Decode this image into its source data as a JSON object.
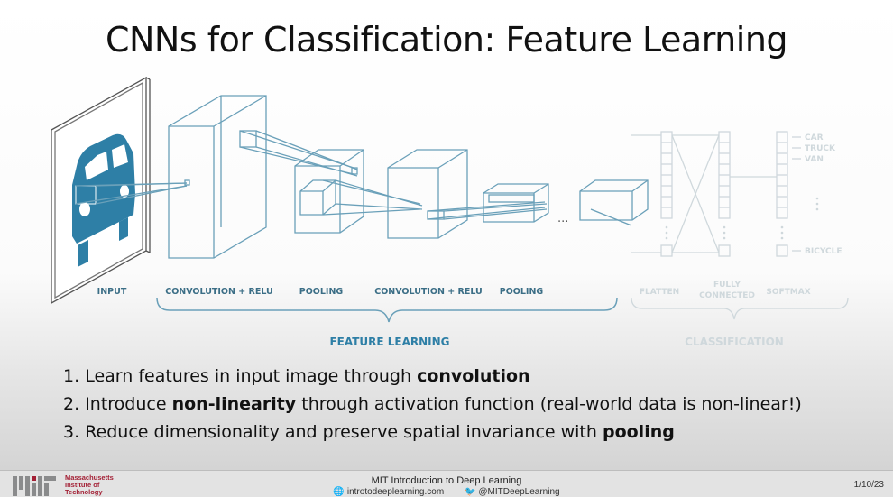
{
  "slide": {
    "title": "CNNs for Classification: Feature Learning"
  },
  "diagram": {
    "labels": {
      "input": "INPUT",
      "conv1": "CONVOLUTION + RELU",
      "pool1": "POOLING",
      "conv2": "CONVOLUTION + RELU",
      "pool2": "POOLING",
      "flatten": "FLATTEN",
      "fully_connected_line1": "FULLY",
      "fully_connected_line2": "CONNECTED",
      "softmax": "SOFTMAX",
      "feature_learning": "FEATURE LEARNING",
      "classification": "CLASSIFICATION",
      "ellipsis": "..."
    },
    "classes": [
      "CAR",
      "TRUCK",
      "VAN",
      "BICYCLE"
    ],
    "colors": {
      "accent": "#2e7fa6",
      "line": "#6aa0b9",
      "faded": "#cfd8dc"
    }
  },
  "bullets": [
    {
      "num": "1.",
      "pre": "Learn features in input image through ",
      "bold": "convolution",
      "post": ""
    },
    {
      "num": "2.",
      "pre": "Introduce ",
      "bold": "non-linearity",
      "post": " through activation function (real-world data is non-linear!)"
    },
    {
      "num": "3.",
      "pre": "Reduce dimensionality and preserve spatial invariance with ",
      "bold": "pooling",
      "post": ""
    }
  ],
  "footer": {
    "institution_line1": "Massachusetts",
    "institution_line2": "Institute of",
    "institution_line3": "Technology",
    "course": "MIT Introduction to Deep Learning",
    "website": "introtodeeplearning.com",
    "twitter": "@MITDeepLearning",
    "date": "1/10/23"
  }
}
